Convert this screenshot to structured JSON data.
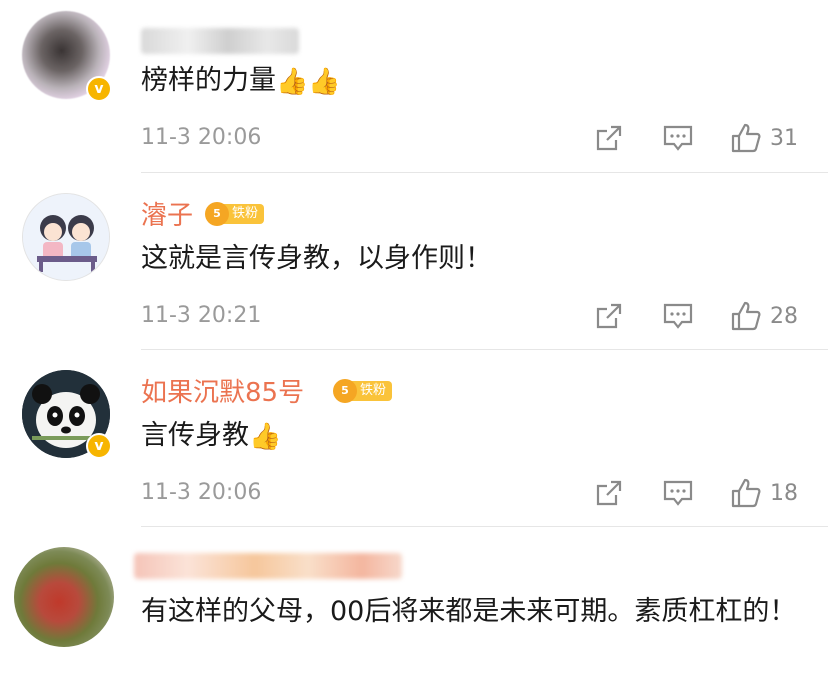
{
  "comments": [
    {
      "username": "",
      "has_fan_badge": false,
      "text": "榜样的力量",
      "emoji": "👍👍",
      "time": "11-3 20:06",
      "likes": "31"
    },
    {
      "username": "濬子",
      "fan_level": "5",
      "fan_label": "铁粉",
      "text": "这就是言传身教，以身作则！",
      "time": "11-3 20:21",
      "likes": "28"
    },
    {
      "username": "如果沉默85号",
      "fan_level": "5",
      "fan_label": "铁粉",
      "text": "言传身教",
      "emoji": "👍",
      "time": "11-3 20:06",
      "likes": "18"
    },
    {
      "username": "",
      "text": "有这样的父母，00后将来都是未来可期。素质杠杠的！"
    }
  ],
  "icons": {
    "repost": "repost-icon",
    "comment": "comment-icon",
    "like": "like-icon",
    "verified": "verified-badge-icon",
    "crown": "crown-icon"
  },
  "colors": {
    "username": "#eb7350",
    "fan_badge": "#fac33a",
    "verified": "#f7b500",
    "meta": "#9a9a9a"
  }
}
